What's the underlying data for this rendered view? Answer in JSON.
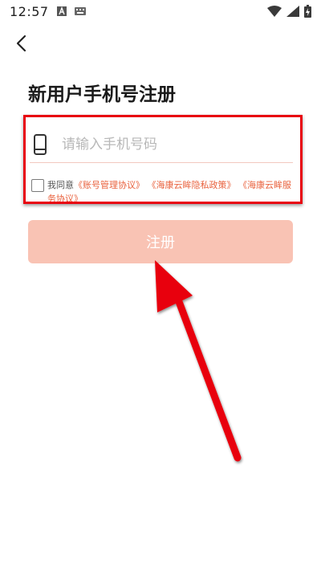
{
  "status_bar": {
    "time": "12:57"
  },
  "page": {
    "title": "新用户手机号注册"
  },
  "form": {
    "phone_placeholder": "请输入手机号码",
    "agree_prefix": "我同意",
    "agreement_links": [
      "《账号管理协议》",
      "《海康云眸隐私政策》",
      "《海康云眸服务协议》"
    ],
    "register_label": "注册"
  },
  "colors": {
    "accent": "#e9623e",
    "button_disabled": "#f9c3b4",
    "annotation_red": "#e8000f"
  }
}
